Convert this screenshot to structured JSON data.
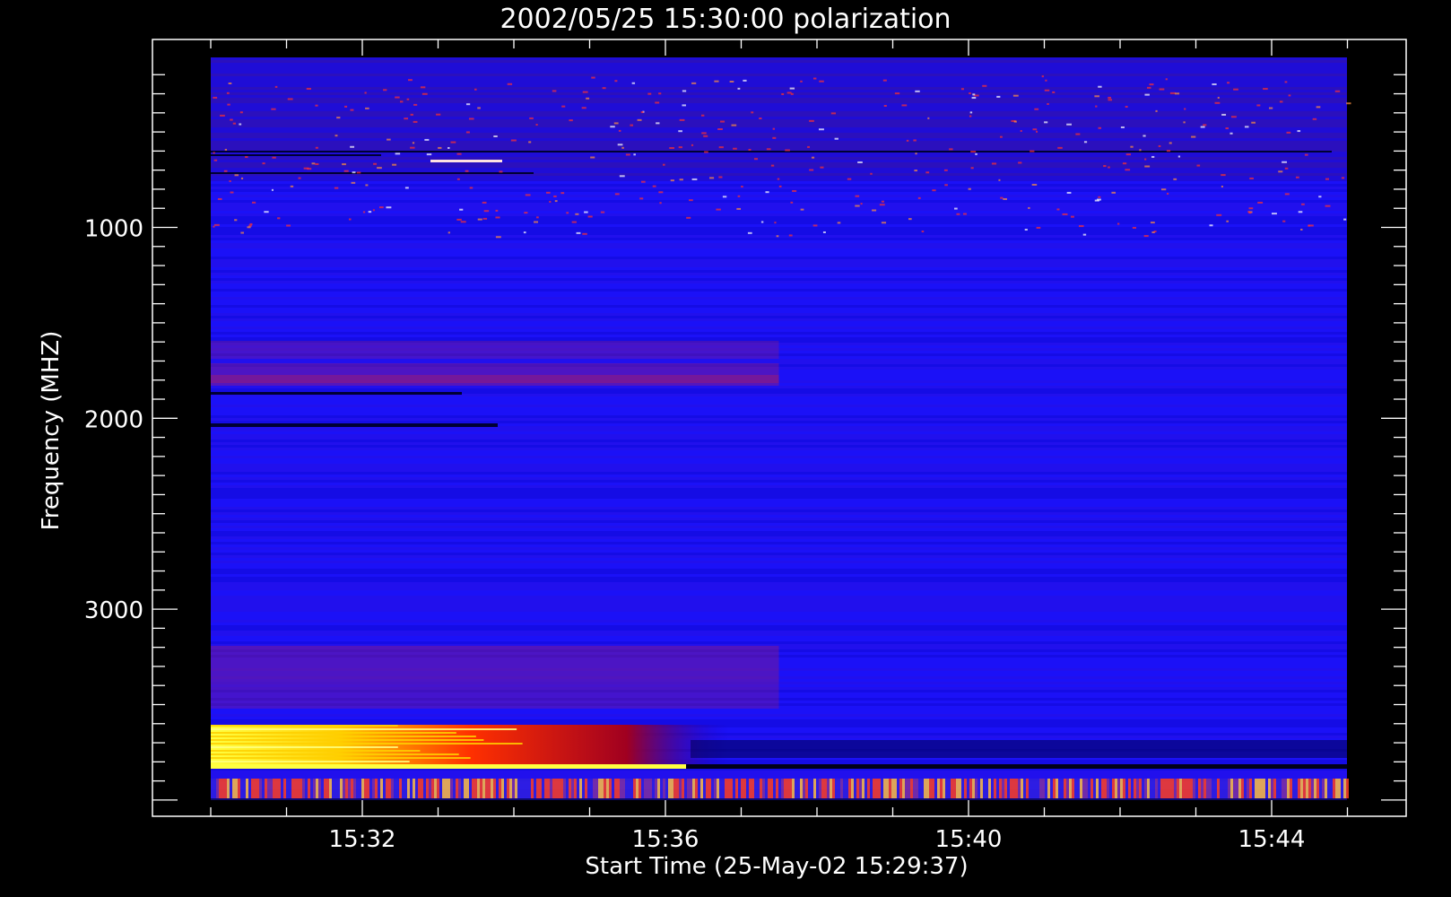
{
  "chart_data": {
    "type": "heatmap",
    "title": "2002/05/25 15:30:00 polarization",
    "xlabel": "Start Time (25-May-02 15:29:37)",
    "ylabel": "Frequency (MHZ)",
    "x_ticks": [
      "15:32",
      "15:36",
      "15:40",
      "15:44"
    ],
    "y_ticks": [
      "1000",
      "2000",
      "3000"
    ],
    "y_tick_values": [
      1000,
      2000,
      3000
    ],
    "ylim": [
      100,
      4200
    ],
    "y_reversed": true,
    "x_start": "15:29:37",
    "x_end": "15:45:00",
    "colormap": "blue-red-yellow-white",
    "colors": {
      "background": "#000000",
      "axes": "#ffffff",
      "low": "#0000ff",
      "mid": "#ff0000",
      "high": "#ffff00"
    }
  }
}
